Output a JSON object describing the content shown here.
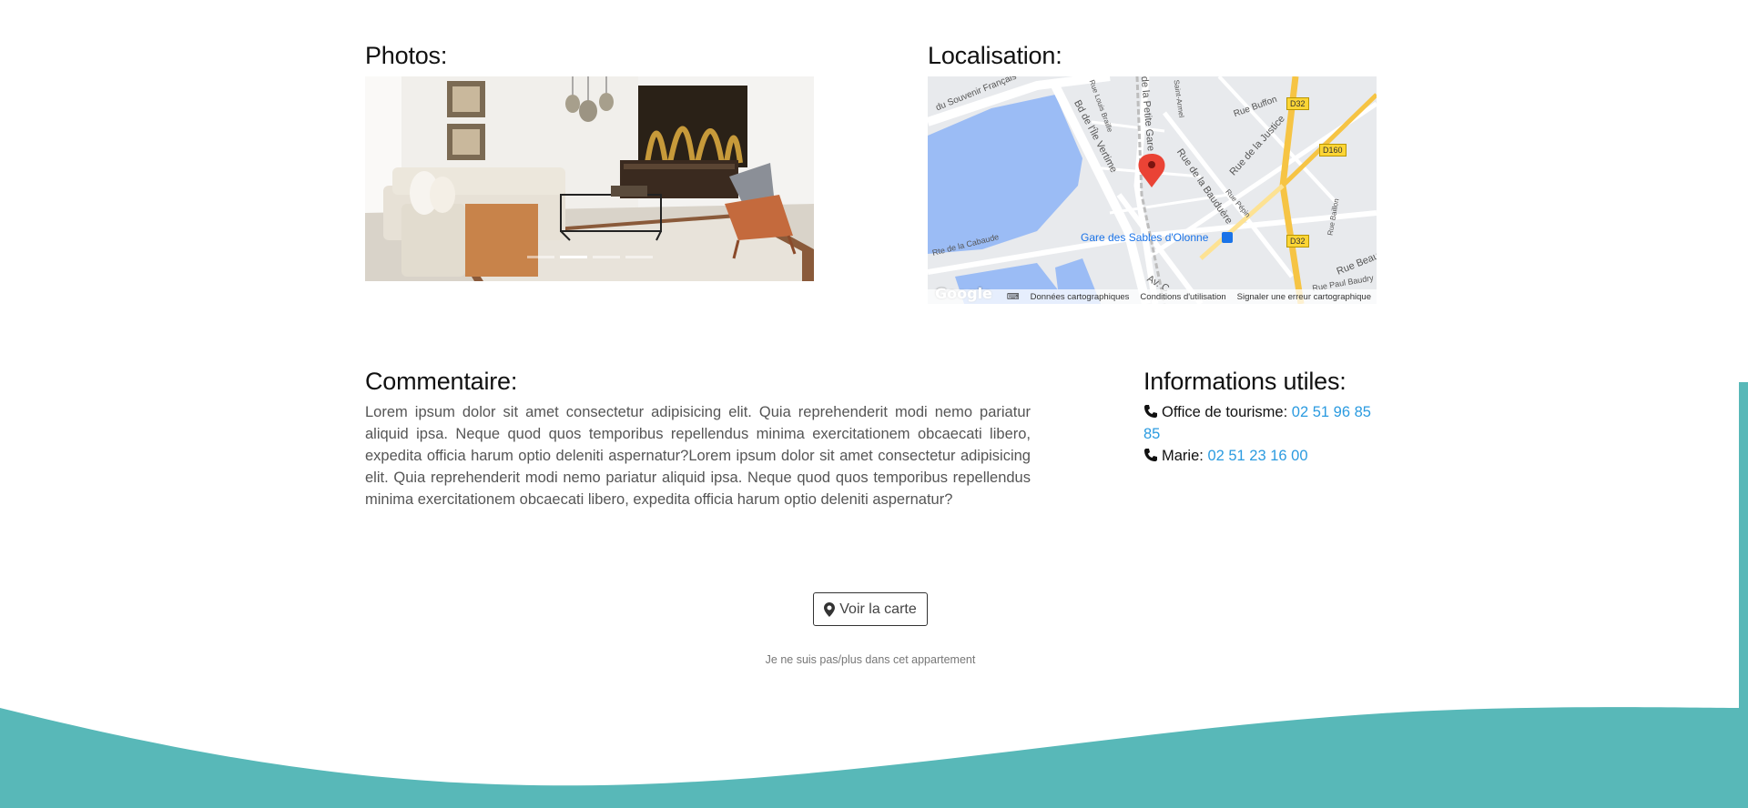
{
  "photos": {
    "title": "Photos:",
    "slide_count": 4,
    "active_slide": 2
  },
  "location": {
    "title": "Localisation:",
    "map": {
      "street_labels": [
        "du Souvenir Français",
        "Bd de l'Île Vertime",
        "Rue Louis Braille",
        "de la Petite Gare",
        "Saint-Armel",
        "Rue Buffon",
        "Rue de la Justice",
        "Rue de la Bauduère",
        "Rue Pépin",
        "Rue Baillon",
        "Rte de la Cabaude",
        "Rue Beau",
        "Rue Paul Baudry",
        "Av. C"
      ],
      "road_badges": [
        "D32",
        "D160",
        "D32"
      ],
      "poi_label": "Gare des Sables d'Olonne",
      "logo": "Google",
      "footer_links": [
        "Données cartographiques",
        "Conditions d'utilisation",
        "Signaler une erreur cartographique"
      ]
    }
  },
  "comment": {
    "title": "Commentaire:",
    "text": "Lorem ipsum dolor sit amet consectetur adipisicing elit. Quia reprehenderit modi nemo pariatur aliquid ipsa. Neque quod quos temporibus repellendus minima exercitationem obcaecati libero, expedita officia harum optio deleniti aspernatur?Lorem ipsum dolor sit amet consectetur adipisicing elit. Quia reprehenderit modi nemo pariatur aliquid ipsa. Neque quod quos temporibus repellendus minima exercitationem obcaecati libero, expedita officia harum optio deleniti aspernatur?"
  },
  "info": {
    "title": "Informations utiles:",
    "contacts": [
      {
        "label": "Office de tourisme:",
        "phone": "02 51 96 85 85"
      },
      {
        "label": "Marie:",
        "phone": "02 51 23 16 00"
      }
    ]
  },
  "actions": {
    "map_button_label": "Voir la carte",
    "not_here_label": "Je ne suis pas/plus dans cet appartement"
  },
  "colors": {
    "wave": "#58b8b8",
    "link": "#2b9be0",
    "water": "#9bbcf5"
  }
}
